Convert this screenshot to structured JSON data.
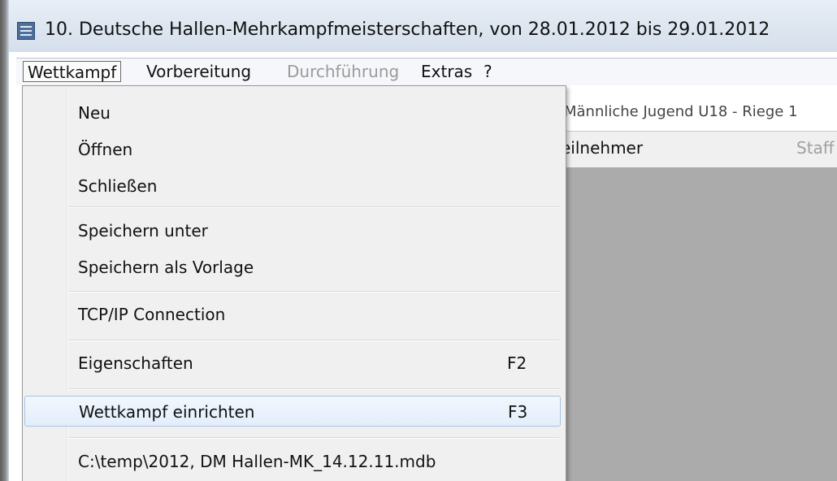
{
  "window": {
    "title": "10. Deutsche Hallen-Mehrkampfmeisterschaften, von 28.01.2012 bis 29.01.2012",
    "icon": "app-icon"
  },
  "menubar": {
    "items": [
      {
        "label": "Wettkampf",
        "state": "active"
      },
      {
        "label": "Vorbereitung",
        "state": "normal"
      },
      {
        "label": "Durchführung",
        "state": "disabled"
      },
      {
        "label": "Extras",
        "state": "normal"
      },
      {
        "label": "?",
        "state": "normal"
      }
    ]
  },
  "dropdown": {
    "items": [
      {
        "label": "Neu",
        "shortcut": ""
      },
      {
        "label": "Öffnen",
        "shortcut": ""
      },
      {
        "label": "Schließen",
        "shortcut": ""
      },
      {
        "label": "Speichern unter",
        "shortcut": ""
      },
      {
        "label": "Speichern als Vorlage",
        "shortcut": ""
      },
      {
        "label": "TCP/IP Connection",
        "shortcut": ""
      },
      {
        "label": "Eigenschaften",
        "shortcut": "F2"
      },
      {
        "label": "Wettkampf einrichten",
        "shortcut": "F3",
        "highlighted": true
      },
      {
        "label": "C:\\temp\\2012, DM Hallen-MK_14.12.11.mdb",
        "shortcut": ""
      }
    ]
  },
  "background": {
    "riege_header": "Männliche Jugend U18 - Riege 1",
    "tab_teilnehmer": "eilnehmer",
    "tab_staffel": "Staff"
  },
  "colors": {
    "highlight_border": "#a8c3e3",
    "disabled_text": "#9a9a9a",
    "content_grey": "#ababab"
  }
}
